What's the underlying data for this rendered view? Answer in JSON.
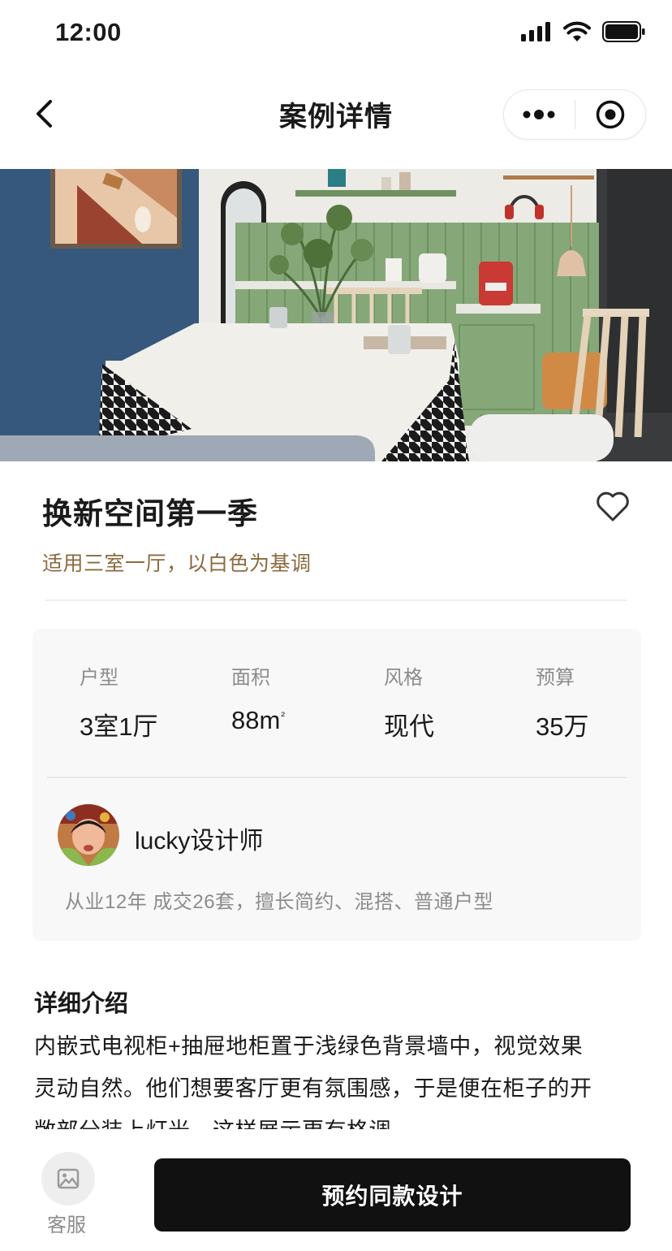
{
  "status_bar": {
    "time": "12:00"
  },
  "nav": {
    "title": "案例详情"
  },
  "case": {
    "title": "换新空间第一季",
    "subtitle": "适用三室一厅，以白色为基调"
  },
  "specs": [
    {
      "label": "户型",
      "value": "3室1厅"
    },
    {
      "label": "面积",
      "value": "88m",
      "sup": "²"
    },
    {
      "label": "风格",
      "value": "现代"
    },
    {
      "label": "预算",
      "value": "35万"
    }
  ],
  "designer": {
    "name": "lucky设计师",
    "description": "从业12年 成交26套，擅长简约、混搭、普通户型"
  },
  "detail": {
    "title": "详细介绍",
    "text": "内嵌式电视柜+抽屉地柜置于浅绿色背景墙中，视觉效果灵动自然。他们想要客厅更有氛围感，于是便在柜子的开敞部分装上灯光，这样展示更有格调"
  },
  "bottom_bar": {
    "service_label": "客服",
    "book_label": "预约同款设计"
  },
  "colors": {
    "accent_text": "#8b6a3e",
    "button_bg": "#111111",
    "card_bg": "#f8f8f8"
  }
}
